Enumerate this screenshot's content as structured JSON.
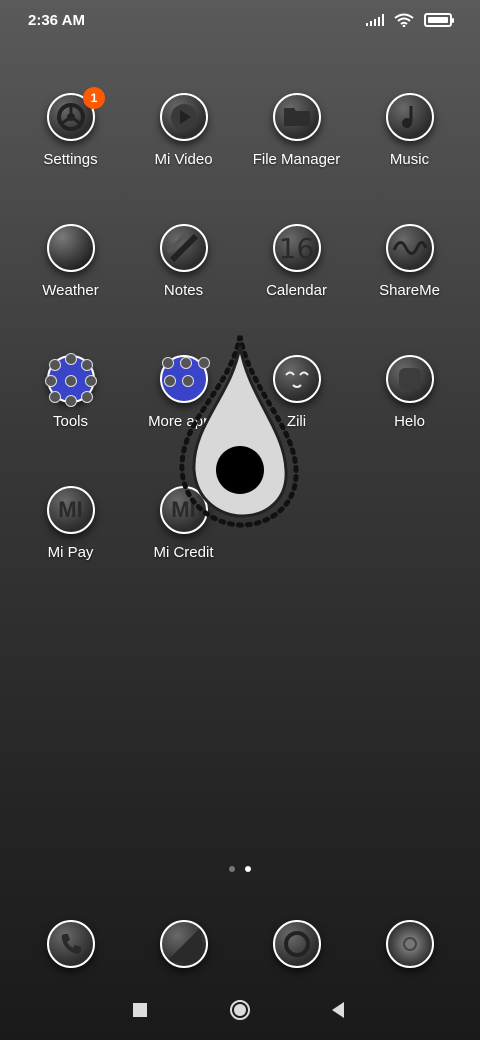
{
  "status": {
    "time": "2:36 AM"
  },
  "apps": [
    {
      "label": "Settings",
      "badge": "1",
      "icon": "settings-icon"
    },
    {
      "label": "Mi Video",
      "icon": "play-icon"
    },
    {
      "label": "File Manager",
      "icon": "folder-icon"
    },
    {
      "label": "Music",
      "icon": "music-note-icon"
    },
    {
      "label": "Weather",
      "icon": "weather-icon"
    },
    {
      "label": "Notes",
      "icon": "notes-icon"
    },
    {
      "label": "Calendar",
      "icon": "calendar-icon",
      "icon_text": "16"
    },
    {
      "label": "ShareMe",
      "icon": "shareme-icon"
    },
    {
      "label": "Tools",
      "icon": "app-folder-icon"
    },
    {
      "label": "More apps",
      "icon": "app-folder-icon"
    },
    {
      "label": "Zili",
      "icon": "zili-face-icon"
    },
    {
      "label": "Helo",
      "icon": "helo-icon"
    },
    {
      "label": "Mi Pay",
      "icon": "mi-pay-icon",
      "icon_text": "MI"
    },
    {
      "label": "Mi Credit",
      "icon": "mi-credit-icon",
      "icon_text": "MI"
    }
  ],
  "dock": [
    {
      "icon": "phone-icon"
    },
    {
      "icon": "messages-icon"
    },
    {
      "icon": "browser-icon"
    },
    {
      "icon": "camera-icon"
    }
  ],
  "page_indicator": {
    "current": 2,
    "total": 2
  },
  "nav": {
    "recents": "recents-icon",
    "home": "home-icon",
    "back": "back-icon"
  }
}
